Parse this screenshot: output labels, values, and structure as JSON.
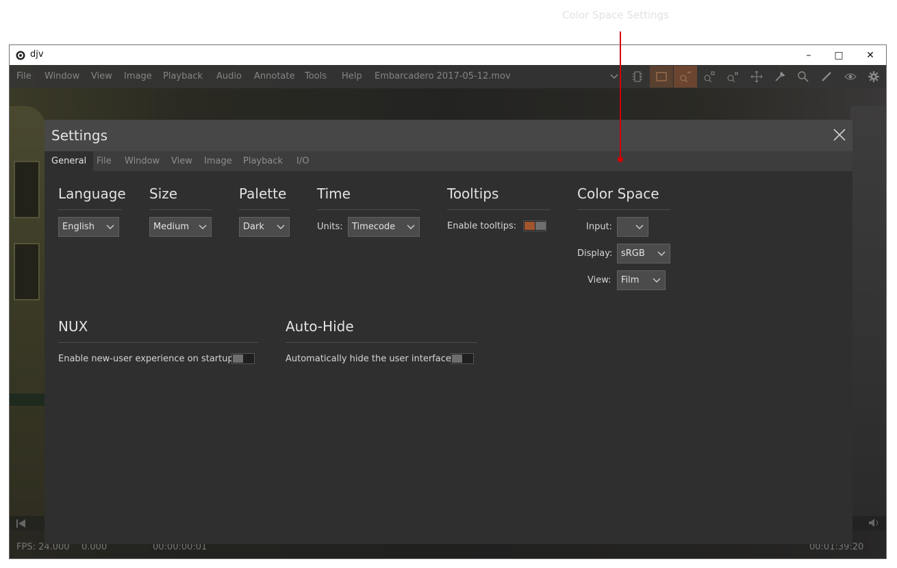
{
  "annotation": {
    "label": "Color Space Settings",
    "color": "#d20000"
  },
  "window": {
    "title": "djv",
    "controls": {
      "minimize": "–",
      "maximize": "□",
      "close": "✕"
    }
  },
  "menubar": {
    "items": [
      "File",
      "Window",
      "View",
      "Image",
      "Playback",
      "Audio",
      "Annotate",
      "Tools",
      "Help"
    ],
    "file_name": "Embarcadero 2017-05-12.mov",
    "toolbar_icons": [
      "chevron-down-icon",
      "timeline-icon",
      "frame-icon",
      "zoom-fit-icon",
      "zoom-reset-icon",
      "zoom-one-icon",
      "pan-icon",
      "color-picker-icon",
      "magnify-icon",
      "annotate-pen-icon",
      "eye-icon",
      "gear-icon"
    ]
  },
  "bottom_bar": {
    "fps": "FPS: 24.000",
    "speed": "0.000",
    "current_time": "00:00:00:01",
    "duration": "00:01:39:20"
  },
  "settings": {
    "title": "Settings",
    "tabs": [
      "General",
      "File",
      "Window",
      "View",
      "Image",
      "Playback",
      "I/O"
    ],
    "active_tab": "General",
    "language": {
      "title": "Language",
      "value": "English"
    },
    "size": {
      "title": "Size",
      "value": "Medium"
    },
    "palette": {
      "title": "Palette",
      "value": "Dark"
    },
    "time": {
      "title": "Time",
      "units_label": "Units:",
      "units_value": "Timecode"
    },
    "tooltips": {
      "title": "Tooltips",
      "enable_label": "Enable tooltips:",
      "enabled": true
    },
    "color_space": {
      "title": "Color Space",
      "input_label": "Input:",
      "input_value": "",
      "display_label": "Display:",
      "display_value": "sRGB",
      "view_label": "View:",
      "view_value": "Film"
    },
    "nux": {
      "title": "NUX",
      "enable_label": "Enable new-user experience on startup:",
      "enabled": false
    },
    "auto_hide": {
      "title": "Auto-Hide",
      "enable_label": "Automatically hide the user interface:",
      "enabled": false
    }
  },
  "colors": {
    "accent": "#a3552e",
    "panel": "#2f2f2f",
    "header": "#474747",
    "text": "#e3e3e3"
  }
}
